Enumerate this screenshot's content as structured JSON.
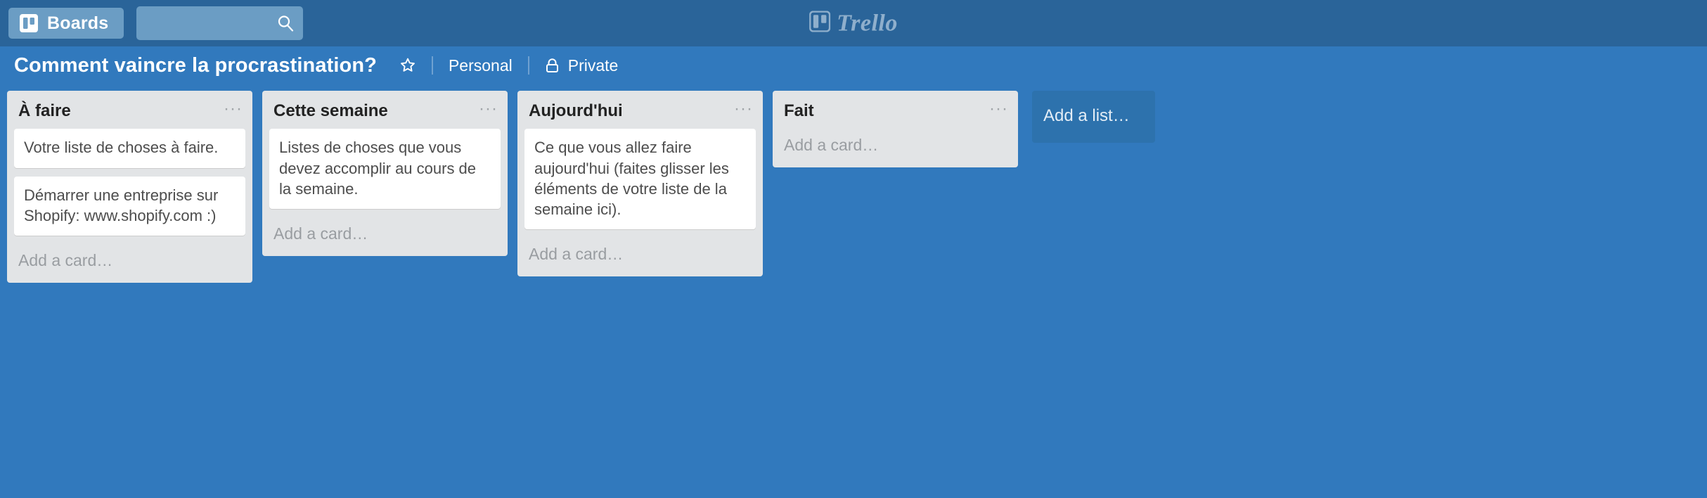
{
  "header": {
    "boards_button_label": "Boards",
    "boards_icon": "board-icon",
    "search_placeholder": "",
    "search_value": "",
    "search_icon": "search-icon",
    "logo_text": "Trello",
    "logo_icon": "trello-board-icon"
  },
  "board_bar": {
    "title": "Comment vaincre la procrastination?",
    "star_icon": "star-outline-icon",
    "organization": "Personal",
    "visibility": "Private",
    "lock_icon": "lock-icon"
  },
  "colors": {
    "header_bg": "#2a6499",
    "board_bg": "#3179bd",
    "list_bg": "#e2e4e6",
    "card_bg": "#ffffff",
    "add_list_bg": "#2d72ad",
    "muted_text": "#999da1"
  },
  "board": {
    "add_list_label": "Add a list…",
    "add_card_label": "Add a card…",
    "list_menu_icon": "···",
    "lists": [
      {
        "title": "À faire",
        "cards": [
          "Votre liste de choses à faire.",
          "Démarrer une entreprise sur Shopify: www.shopify.com :)"
        ]
      },
      {
        "title": "Cette semaine",
        "cards": [
          "Listes de choses que vous devez accomplir au cours de la semaine."
        ]
      },
      {
        "title": "Aujourd'hui",
        "cards": [
          "Ce que vous allez faire aujourd'hui (faites glisser les éléments de votre liste de la semaine ici)."
        ]
      },
      {
        "title": "Fait",
        "cards": []
      }
    ]
  }
}
